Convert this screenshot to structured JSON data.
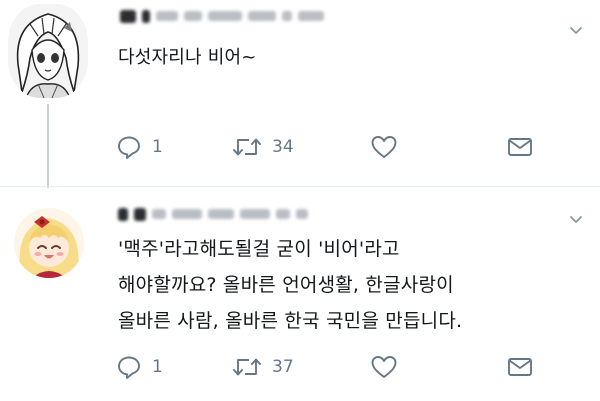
{
  "tweets": [
    {
      "text": "다섯자리나 비어~",
      "reply_count": "1",
      "retweet_count": "34",
      "icons": [
        "reply-icon",
        "retweet-icon",
        "like-icon",
        "message-icon",
        "chevron-down-icon"
      ]
    },
    {
      "text": "'맥주'라고해도될걸 굳이 '비어'라고\n해야할까요? 올바른 언어생활, 한글사랑이\n올바른 사람, 올바른 한국 국민을 만듭니다.",
      "reply_count": "1",
      "retweet_count": "37",
      "icons": [
        "reply-icon",
        "retweet-icon",
        "like-icon",
        "message-icon",
        "chevron-down-icon"
      ]
    }
  ],
  "colors": {
    "text": "#14171a",
    "secondary": "#657786",
    "thread_line": "#c7d0d8",
    "divider": "#e6ecf0"
  }
}
